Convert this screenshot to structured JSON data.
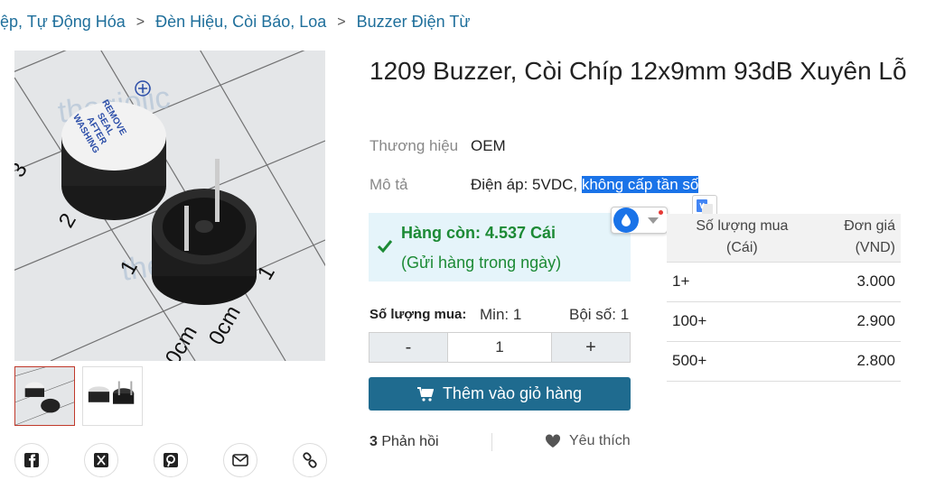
{
  "breadcrumb": {
    "items": [
      "ệp, Tự Động Hóa",
      "Đèn Hiệu, Còi Báo, Loa",
      "Buzzer Điện Từ"
    ],
    "separator": ">"
  },
  "product": {
    "title": "1209 Buzzer, Còi Chíp 12x9mm 93dB Xuyên Lỗ",
    "brand_label": "Thương hiệu",
    "brand_value": "OEM",
    "desc_label": "Mô tả",
    "desc_plain": "Điện áp: 5VDC, ",
    "desc_highlight": "không cấp tần số",
    "image_watermark": "thegiolic",
    "image_text": {
      "seal": [
        "REMOVE",
        "SEAL",
        "AFTER",
        "WASHING"
      ],
      "ruler": [
        "0cm",
        "1",
        "2",
        "3"
      ]
    }
  },
  "stock": {
    "line1": "Hàng còn: 4.537 Cái",
    "line2": "(Gửi hàng trong ngày)"
  },
  "quantity": {
    "label": "Số lượng mua:",
    "min": "Min: 1",
    "multiple": "Bội số: 1",
    "minus": "-",
    "value": "1",
    "plus": "+"
  },
  "cart": {
    "label": "Thêm vào giỏ hàng"
  },
  "feedback": {
    "count": "3",
    "label": " Phản hồi"
  },
  "favorite": {
    "label": "Yêu thích"
  },
  "price_table": {
    "headers": [
      "Số lượng mua\n(Cái)",
      "Đơn giá\n(VND)"
    ],
    "rows": [
      {
        "qty": "1+",
        "price": "3.000"
      },
      {
        "qty": "100+",
        "price": "2.900"
      },
      {
        "qty": "500+",
        "price": "2.800"
      }
    ]
  },
  "share": [
    "facebook-icon",
    "x-icon",
    "pinterest-icon",
    "mail-icon",
    "link-icon"
  ],
  "colors": {
    "link": "#1f6f9b",
    "stock_bg": "#e5f4fa",
    "stock_text": "#1c8a35",
    "cart_bg": "#1f6b8f",
    "highlight": "#1a73e8"
  }
}
